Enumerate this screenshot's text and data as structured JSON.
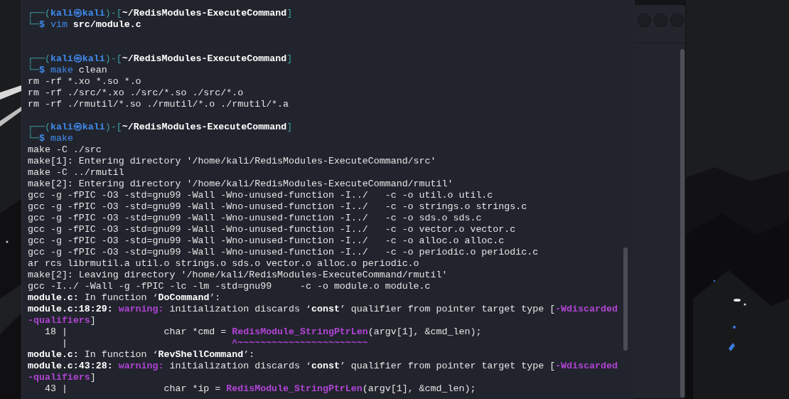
{
  "terminal": {
    "lines": [
      {
        "kind": "text",
        "segments": [
          {
            "text": "┌──(",
            "kind": "frame"
          },
          {
            "text": "kali㉿kali",
            "kind": "user"
          },
          {
            "text": ")-[",
            "kind": "frame"
          },
          {
            "text": "~/RedisModules-ExecuteCommand",
            "kind": "path"
          },
          {
            "text": "]",
            "kind": "frame"
          }
        ]
      },
      {
        "kind": "text",
        "segments": [
          {
            "text": "└─",
            "kind": "frame"
          },
          {
            "text": "$ ",
            "kind": "dollar"
          },
          {
            "text": "vim ",
            "kind": "command"
          },
          {
            "text": "src/module.c",
            "kind": "path"
          }
        ]
      },
      {
        "kind": "blank"
      },
      {
        "kind": "blank"
      },
      {
        "kind": "text",
        "segments": [
          {
            "text": "┌──(",
            "kind": "frame"
          },
          {
            "text": "kali㉿kali",
            "kind": "user"
          },
          {
            "text": ")-[",
            "kind": "frame"
          },
          {
            "text": "~/RedisModules-ExecuteCommand",
            "kind": "path"
          },
          {
            "text": "]",
            "kind": "frame"
          }
        ]
      },
      {
        "kind": "text",
        "segments": [
          {
            "text": "└─",
            "kind": "frame"
          },
          {
            "text": "$ ",
            "kind": "dollar"
          },
          {
            "text": "make ",
            "kind": "command"
          },
          {
            "text": "clean",
            "kind": "plain"
          }
        ]
      },
      {
        "kind": "text",
        "segments": [
          {
            "text": "rm -rf *.xo *.so *.o",
            "kind": "plain"
          }
        ]
      },
      {
        "kind": "text",
        "segments": [
          {
            "text": "rm -rf ./src/*.xo ./src/*.so ./src/*.o",
            "kind": "plain"
          }
        ]
      },
      {
        "kind": "text",
        "segments": [
          {
            "text": "rm -rf ./rmutil/*.so ./rmutil/*.o ./rmutil/*.a",
            "kind": "plain"
          }
        ]
      },
      {
        "kind": "blank"
      },
      {
        "kind": "text",
        "segments": [
          {
            "text": "┌──(",
            "kind": "frame"
          },
          {
            "text": "kali㉿kali",
            "kind": "user"
          },
          {
            "text": ")-[",
            "kind": "frame"
          },
          {
            "text": "~/RedisModules-ExecuteCommand",
            "kind": "path"
          },
          {
            "text": "]",
            "kind": "frame"
          }
        ]
      },
      {
        "kind": "text",
        "segments": [
          {
            "text": "└─",
            "kind": "frame"
          },
          {
            "text": "$ ",
            "kind": "dollar"
          },
          {
            "text": "make",
            "kind": "command"
          }
        ]
      },
      {
        "kind": "text",
        "segments": [
          {
            "text": "make -C ./src",
            "kind": "plain"
          }
        ]
      },
      {
        "kind": "text",
        "segments": [
          {
            "text": "make[1]: Entering directory '/home/kali/RedisModules-ExecuteCommand/src'",
            "kind": "plain"
          }
        ]
      },
      {
        "kind": "text",
        "segments": [
          {
            "text": "make -C ../rmutil",
            "kind": "plain"
          }
        ]
      },
      {
        "kind": "text",
        "segments": [
          {
            "text": "make[2]: Entering directory '/home/kali/RedisModules-ExecuteCommand/rmutil'",
            "kind": "plain"
          }
        ]
      },
      {
        "kind": "text",
        "segments": [
          {
            "text": "gcc -g -fPIC -O3 -std=gnu99 -Wall -Wno-unused-function -I../   -c -o util.o util.c",
            "kind": "plain"
          }
        ]
      },
      {
        "kind": "text",
        "segments": [
          {
            "text": "gcc -g -fPIC -O3 -std=gnu99 -Wall -Wno-unused-function -I../   -c -o strings.o strings.c",
            "kind": "plain"
          }
        ]
      },
      {
        "kind": "text",
        "segments": [
          {
            "text": "gcc -g -fPIC -O3 -std=gnu99 -Wall -Wno-unused-function -I../   -c -o sds.o sds.c",
            "kind": "plain"
          }
        ]
      },
      {
        "kind": "text",
        "segments": [
          {
            "text": "gcc -g -fPIC -O3 -std=gnu99 -Wall -Wno-unused-function -I../   -c -o vector.o vector.c",
            "kind": "plain"
          }
        ]
      },
      {
        "kind": "text",
        "segments": [
          {
            "text": "gcc -g -fPIC -O3 -std=gnu99 -Wall -Wno-unused-function -I../   -c -o alloc.o alloc.c",
            "kind": "plain"
          }
        ]
      },
      {
        "kind": "text",
        "segments": [
          {
            "text": "gcc -g -fPIC -O3 -std=gnu99 -Wall -Wno-unused-function -I../   -c -o periodic.o periodic.c",
            "kind": "plain"
          }
        ]
      },
      {
        "kind": "text",
        "segments": [
          {
            "text": "ar rcs librmutil.a util.o strings.o sds.o vector.o alloc.o periodic.o",
            "kind": "plain"
          }
        ]
      },
      {
        "kind": "text",
        "segments": [
          {
            "text": "make[2]: Leaving directory '/home/kali/RedisModules-ExecuteCommand/rmutil'",
            "kind": "plain"
          }
        ]
      },
      {
        "kind": "text",
        "segments": [
          {
            "text": "gcc -I../ -Wall -g -fPIC -lc -lm -std=gnu99     -c -o module.o module.c",
            "kind": "plain"
          }
        ]
      },
      {
        "kind": "text",
        "segments": [
          {
            "text": "module.c:",
            "kind": "bold"
          },
          {
            "text": " In function ‘",
            "kind": "plain"
          },
          {
            "text": "DoCommand",
            "kind": "bold"
          },
          {
            "text": "’:",
            "kind": "plain"
          }
        ]
      },
      {
        "kind": "text",
        "segments": [
          {
            "text": "module.c:18:29: ",
            "kind": "bold"
          },
          {
            "text": "warning:",
            "kind": "warning"
          },
          {
            "text": " initialization discards ‘",
            "kind": "plain"
          },
          {
            "text": "const",
            "kind": "bold"
          },
          {
            "text": "’ qualifier from pointer target type [",
            "kind": "plain"
          },
          {
            "text": "-Wdiscarded",
            "kind": "warning"
          }
        ]
      },
      {
        "kind": "text",
        "segments": [
          {
            "text": "-qualifiers",
            "kind": "warning"
          },
          {
            "text": "]",
            "kind": "plain"
          }
        ]
      },
      {
        "kind": "text",
        "segments": [
          {
            "text": "   18 |                 char *cmd = ",
            "kind": "plain"
          },
          {
            "text": "RedisModule_StringPtrLen",
            "kind": "warning"
          },
          {
            "text": "(argv[1], &cmd_len);",
            "kind": "plain"
          }
        ]
      },
      {
        "kind": "text",
        "segments": [
          {
            "text": "      |                             ",
            "kind": "plain"
          },
          {
            "text": "^~~~~~~~~~~~~~~~~~~~~~~~",
            "kind": "warning"
          }
        ]
      },
      {
        "kind": "text",
        "segments": [
          {
            "text": "module.c:",
            "kind": "bold"
          },
          {
            "text": " In function ‘",
            "kind": "plain"
          },
          {
            "text": "RevShellCommand",
            "kind": "bold"
          },
          {
            "text": "’:",
            "kind": "plain"
          }
        ]
      },
      {
        "kind": "text",
        "segments": [
          {
            "text": "module.c:43:28: ",
            "kind": "bold"
          },
          {
            "text": "warning:",
            "kind": "warning"
          },
          {
            "text": " initialization discards ‘",
            "kind": "plain"
          },
          {
            "text": "const",
            "kind": "bold"
          },
          {
            "text": "’ qualifier from pointer target type [",
            "kind": "plain"
          },
          {
            "text": "-Wdiscarded",
            "kind": "warning"
          }
        ]
      },
      {
        "kind": "text",
        "segments": [
          {
            "text": "-qualifiers",
            "kind": "warning"
          },
          {
            "text": "]",
            "kind": "plain"
          }
        ]
      },
      {
        "kind": "text",
        "segments": [
          {
            "text": "   43 |                 char *ip = ",
            "kind": "plain"
          },
          {
            "text": "RedisModule_StringPtrLen",
            "kind": "warning"
          },
          {
            "text": "(argv[1], &cmd_len);",
            "kind": "plain"
          }
        ]
      }
    ]
  }
}
